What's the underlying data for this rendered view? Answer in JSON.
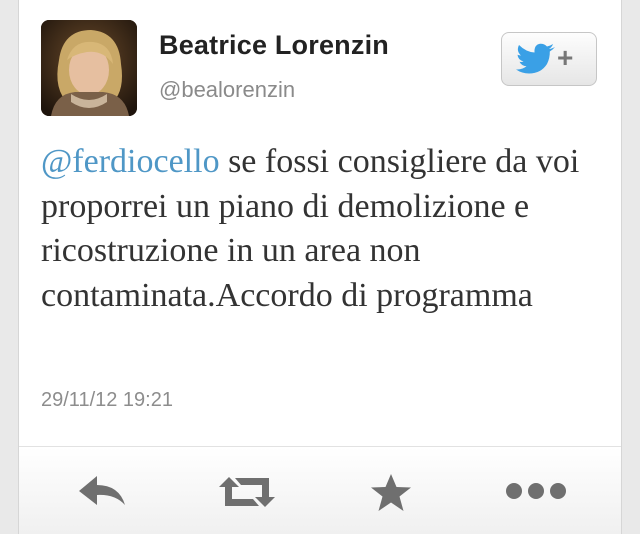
{
  "profile": {
    "display_name": "Beatrice Lorenzin",
    "handle": "@bealorenzin"
  },
  "follow_button": {
    "icon": "bird-plus-icon",
    "plus_glyph": "+",
    "color": "#3aa0e6"
  },
  "tweet": {
    "mention": "@ferdiocello",
    "text": " se fossi consigliere da voi proporrei un piano di demolizione e ricostruzione in un area non contaminata.Accordo di programma",
    "timestamp": "29/11/12 19:21"
  },
  "actions": [
    {
      "name": "reply",
      "icon": "reply-icon"
    },
    {
      "name": "retweet",
      "icon": "retweet-icon"
    },
    {
      "name": "favorite",
      "icon": "star-icon"
    },
    {
      "name": "more",
      "icon": "more-icon"
    }
  ],
  "colors": {
    "mention": "#4f97c6",
    "icon_gray": "#6f6f6f",
    "text": "#333333"
  }
}
